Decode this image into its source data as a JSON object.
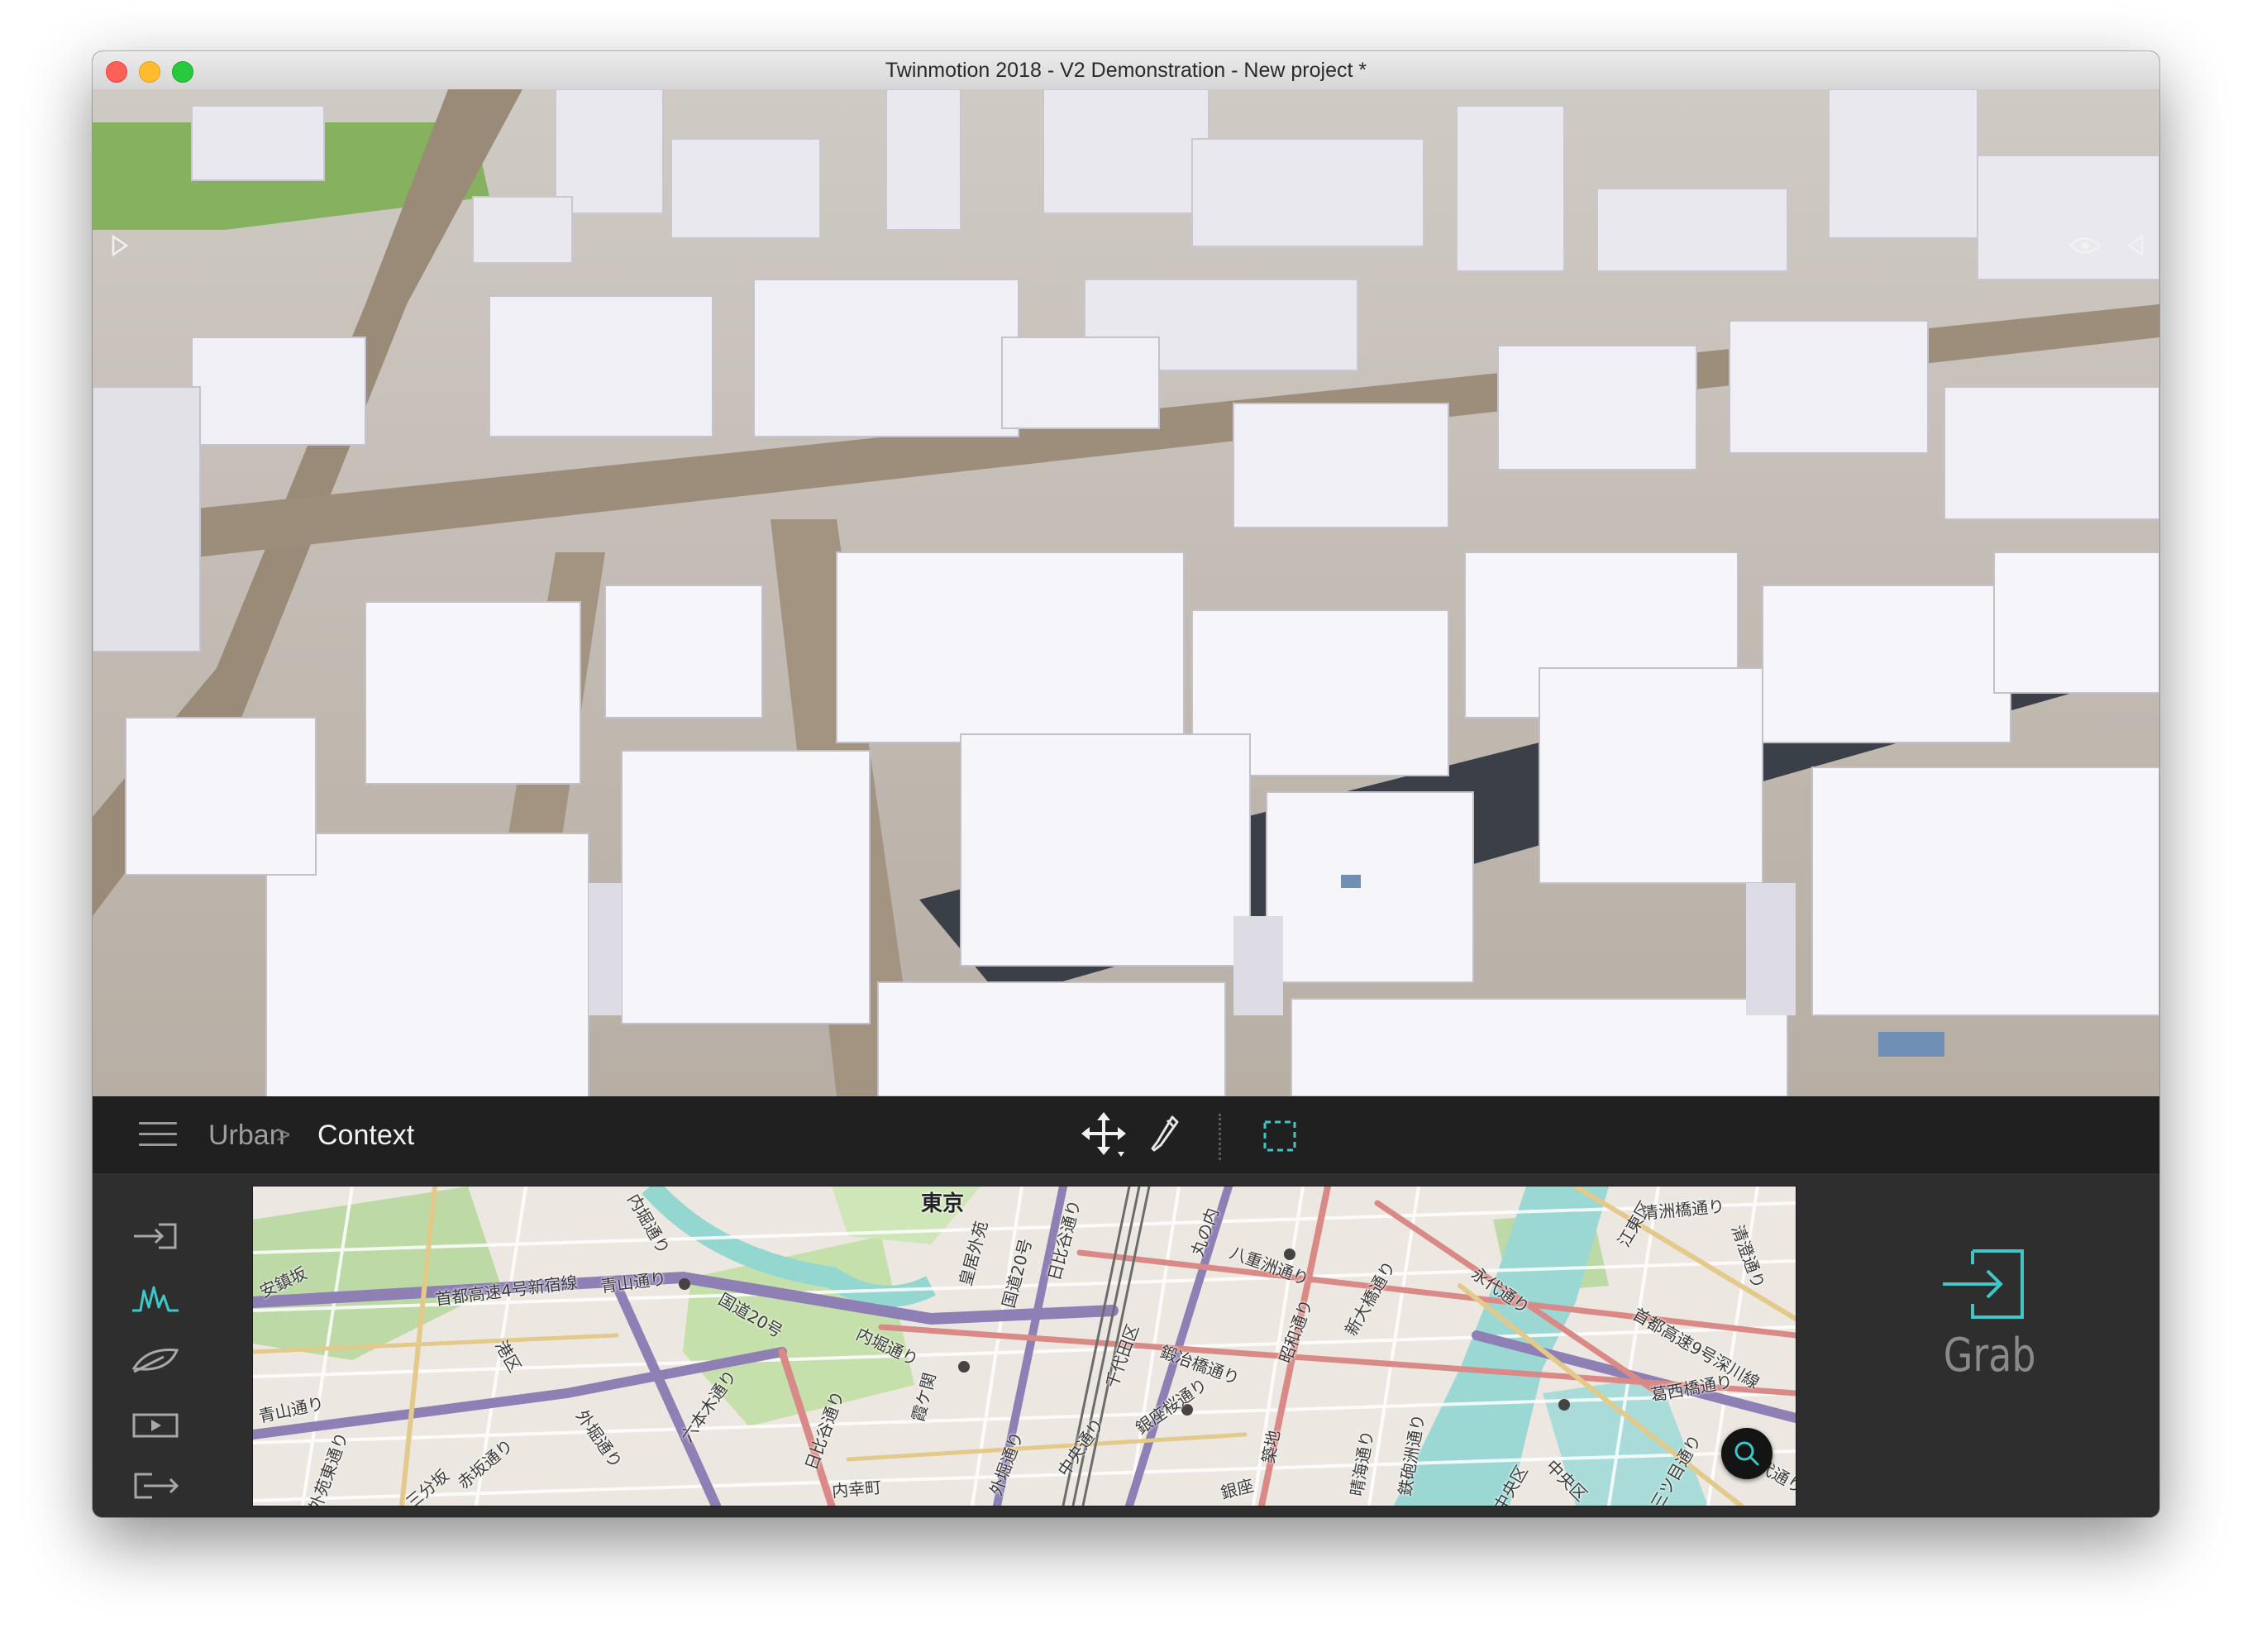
{
  "window": {
    "title": "Twinmotion 2018 - V2 Demonstration - New project *"
  },
  "breadcrumb": {
    "parent": "Urban",
    "separator": ">",
    "current": "Context"
  },
  "sidebar": {
    "items": [
      {
        "icon": "import-icon",
        "active": false
      },
      {
        "icon": "terrain-icon",
        "active": true
      },
      {
        "icon": "vegetation-icon",
        "active": false
      },
      {
        "icon": "media-icon",
        "active": false
      },
      {
        "icon": "export-icon",
        "active": false
      }
    ]
  },
  "map": {
    "title": "東京",
    "labels": [
      "安鎮坂",
      "首都高速4号新宿線",
      "青山通り",
      "内堀通り",
      "国道20号",
      "内堀通り",
      "皇居外苑",
      "国道20号",
      "日比谷通り",
      "千代田区",
      "丸の内",
      "八重洲通り",
      "鍛冶橋通り",
      "昭和通り",
      "新大橋通り",
      "永代通り",
      "江東区",
      "清洲橋通り",
      "清澄通り",
      "首都高速9号深川線",
      "葛西橋通り",
      "青山通り",
      "港区",
      "外堀通り",
      "六本木通り",
      "赤坂通り",
      "日比谷通り",
      "外堀通り",
      "中央通り",
      "銀座桜通り",
      "中央区",
      "永代通り",
      "内幸町",
      "霞ケ関",
      "三分坂",
      "外苑東通り",
      "晴海通り",
      "銀座",
      "築地",
      "鉄砲洲通り",
      "中央区",
      "三ツ目通り"
    ]
  },
  "grab": {
    "label": "Grab"
  },
  "colors": {
    "accent": "#3fc6c6",
    "toolbar_bg": "#202020",
    "panel_bg": "#2e2e2e"
  }
}
